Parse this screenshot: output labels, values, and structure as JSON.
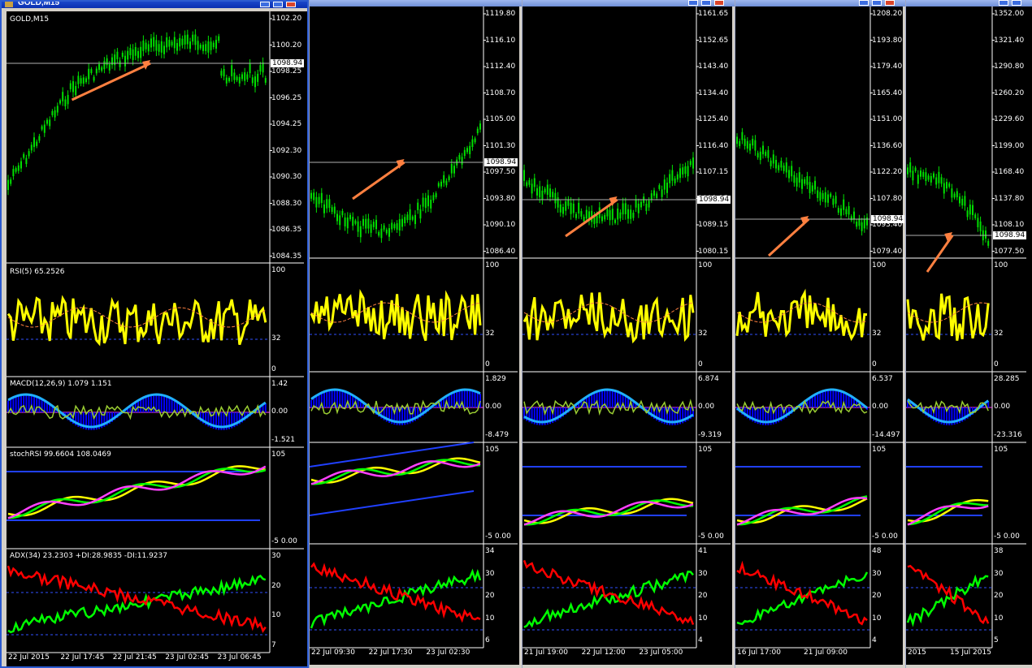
{
  "windows": [
    {
      "title": "GOLD,M15",
      "symbol_label": "GOLD,M15",
      "active": true,
      "last_price": "1098.94",
      "price_ticks": [
        "1102.20",
        "1100.20",
        "1098.25",
        "1096.25",
        "1094.25",
        "1092.30",
        "1090.30",
        "1088.30",
        "1086.35",
        "1084.35"
      ],
      "rsi_label": "RSI(5) 65.2526",
      "rsi_ticks": [
        "100",
        "32",
        "0"
      ],
      "macd_label": "MACD(12,26,9) 1.079 1.151",
      "macd_ticks": [
        "1.42",
        "0.00",
        "-1.521"
      ],
      "stoch_label": "stochRSI 99.6604 108.0469",
      "stoch_ticks": [
        "105",
        "-5 0.00"
      ],
      "adx_label": "ADX(34) 23.2303 +DI:28.9835 -DI:11.9237",
      "adx_ticks": [
        "30",
        "20",
        "10",
        "7"
      ],
      "time_labels": [
        "22 Jul 2015",
        "22 Jul 17:45",
        "22 Jul 21:45",
        "23 Jul 02:45",
        "23 Jul 06:45"
      ]
    },
    {
      "title": "",
      "last_price": "1098.94",
      "price_ticks": [
        "1119.80",
        "1116.10",
        "1112.40",
        "1108.70",
        "1105.00",
        "1101.30",
        "1097.50",
        "1093.80",
        "1090.10",
        "1086.40"
      ],
      "rsi_ticks": [
        "100",
        "32",
        "0"
      ],
      "macd_ticks": [
        "1.829",
        "0.00",
        "-8.479"
      ],
      "stoch_ticks": [
        "105",
        "-5 0.00"
      ],
      "adx_ticks": [
        "34",
        "30",
        "20",
        "10",
        "6"
      ],
      "time_labels": [
        "22 Jul 09:30",
        "22 Jul 17:30",
        "23 Jul 02:30"
      ]
    },
    {
      "title": "",
      "last_price": "1098.94",
      "price_ticks": [
        "1161.65",
        "1152.65",
        "1143.40",
        "1134.40",
        "1125.40",
        "1116.40",
        "1107.15",
        "1098.15",
        "1089.15",
        "1080.15"
      ],
      "rsi_ticks": [
        "100",
        "32",
        "0"
      ],
      "macd_ticks": [
        "6.874",
        "0.00",
        "-9.319"
      ],
      "stoch_ticks": [
        "105",
        "-5 0.00"
      ],
      "adx_ticks": [
        "41",
        "30",
        "20",
        "10",
        "4"
      ],
      "time_labels": [
        "21 Jul 19:00",
        "22 Jul 12:00",
        "23 Jul 05:00"
      ]
    },
    {
      "title": "",
      "last_price": "1098.94",
      "price_ticks": [
        "1208.20",
        "1193.80",
        "1179.40",
        "1165.40",
        "1151.00",
        "1136.60",
        "1122.20",
        "1107.80",
        "1093.40",
        "1079.40"
      ],
      "rsi_ticks": [
        "100",
        "32",
        "0"
      ],
      "macd_ticks": [
        "6.537",
        "0.00",
        "-14.497"
      ],
      "stoch_ticks": [
        "105",
        "-5 0.00"
      ],
      "adx_ticks": [
        "48",
        "30",
        "20",
        "10",
        "4"
      ],
      "time_labels": [
        "16 Jul 17:00",
        "21 Jul 09:00"
      ]
    },
    {
      "title": "",
      "last_price": "1098.94",
      "price_ticks": [
        "1352.00",
        "1321.40",
        "1290.80",
        "1260.20",
        "1229.60",
        "1199.00",
        "1168.40",
        "1137.80",
        "1108.10",
        "1077.50"
      ],
      "rsi_ticks": [
        "100",
        "32",
        "0"
      ],
      "macd_ticks": [
        "28.285",
        "0.00",
        "-23.316"
      ],
      "stoch_ticks": [
        "105",
        "-5 0.00"
      ],
      "adx_ticks": [
        "38",
        "30",
        "20",
        "10",
        "5"
      ],
      "time_labels": [
        "2015",
        "15 Jul 2015"
      ]
    }
  ],
  "colors": {
    "background": "#000000",
    "candle_up": "#00e000",
    "rsi": "#ffff00",
    "arrow": "#ff8040",
    "macd_hist": "#0000ff",
    "adx_plus": "#00ff00",
    "adx_minus": "#ff0000"
  }
}
